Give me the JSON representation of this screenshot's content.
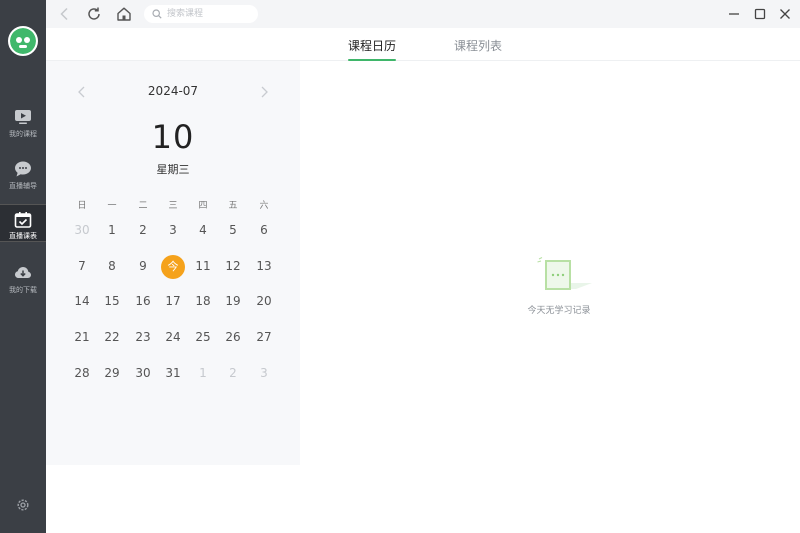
{
  "sidebar": {
    "items": [
      {
        "label": "我的课程",
        "icon": "play-screen-icon"
      },
      {
        "label": "直播辅导",
        "icon": "chat-bubble-icon"
      },
      {
        "label": "直播课表",
        "icon": "calendar-check-icon",
        "active": true
      },
      {
        "label": "我的下载",
        "icon": "download-cloud-icon"
      }
    ]
  },
  "topbar": {
    "search_placeholder": "搜索课程"
  },
  "tabs": [
    {
      "label": "课程日历",
      "active": true
    },
    {
      "label": "课程列表",
      "active": false
    }
  ],
  "calendar": {
    "month": "2024-07",
    "big_day": "10",
    "weekday": "星期三",
    "week_headers": [
      "日",
      "一",
      "二",
      "三",
      "四",
      "五",
      "六"
    ],
    "today_label": "今",
    "weeks": [
      [
        "30",
        "1",
        "2",
        "3",
        "4",
        "5",
        "6"
      ],
      [
        "7",
        "8",
        "9",
        "今",
        "11",
        "12",
        "13"
      ],
      [
        "14",
        "15",
        "16",
        "17",
        "18",
        "19",
        "20"
      ],
      [
        "21",
        "22",
        "23",
        "24",
        "25",
        "26",
        "27"
      ],
      [
        "28",
        "29",
        "30",
        "31",
        "1",
        "2",
        "3"
      ]
    ]
  },
  "empty_state": {
    "message": "今天无学习记录"
  },
  "colors": {
    "rail_bg": "#3b3f45",
    "accent_green": "#3fb66a",
    "today_orange": "#f5a21b"
  }
}
